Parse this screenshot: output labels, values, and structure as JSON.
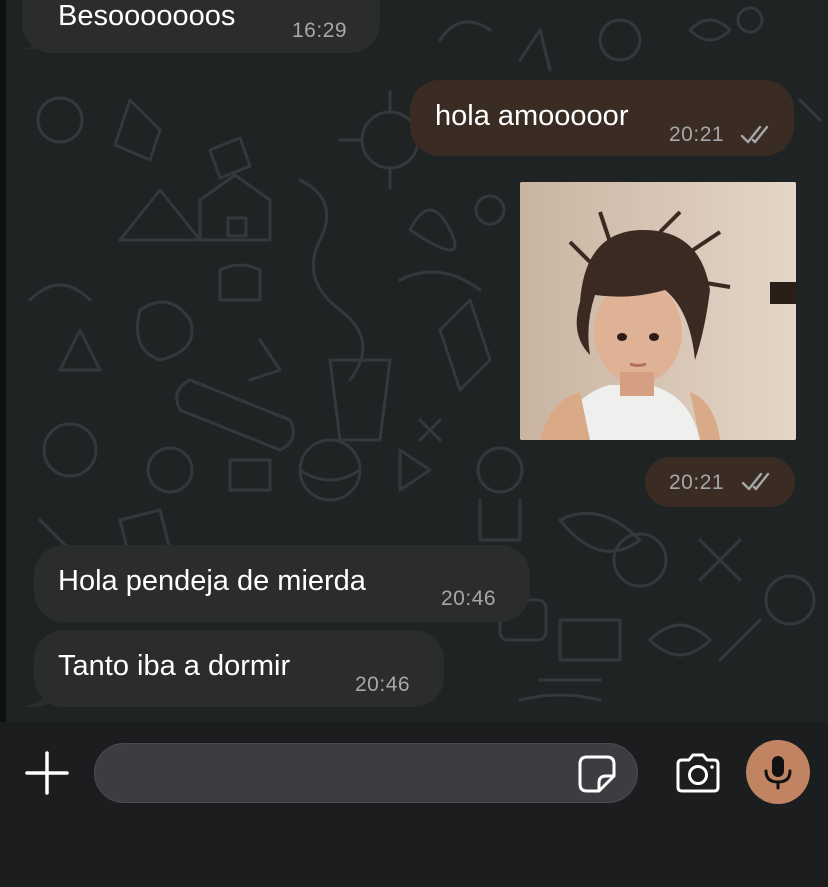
{
  "colors": {
    "chat_background": "#202324",
    "incoming_bubble": "#2a2c2d",
    "outgoing_bubble": "#3a2c22",
    "timestamp": "#a5a7a8",
    "mic_button": "#c08463"
  },
  "messages": [
    {
      "direction": "incoming",
      "text": "Besooooooos",
      "time": "16:29"
    },
    {
      "direction": "outgoing",
      "text": "hola amooooor",
      "time": "20:21",
      "status_icon": "double-check-icon"
    },
    {
      "direction": "outgoing",
      "type": "image",
      "time": "20:21",
      "status_icon": "double-check-icon"
    },
    {
      "direction": "incoming",
      "text": "Hola pendeja de mierda",
      "time": "20:46"
    },
    {
      "direction": "incoming",
      "text": "Tanto iba a dormir",
      "time": "20:46"
    }
  ],
  "composer": {
    "attach_icon": "plus-icon",
    "input_value": "",
    "sticker_icon": "sticker-icon",
    "camera_icon": "camera-icon",
    "mic_icon": "microphone-icon"
  }
}
